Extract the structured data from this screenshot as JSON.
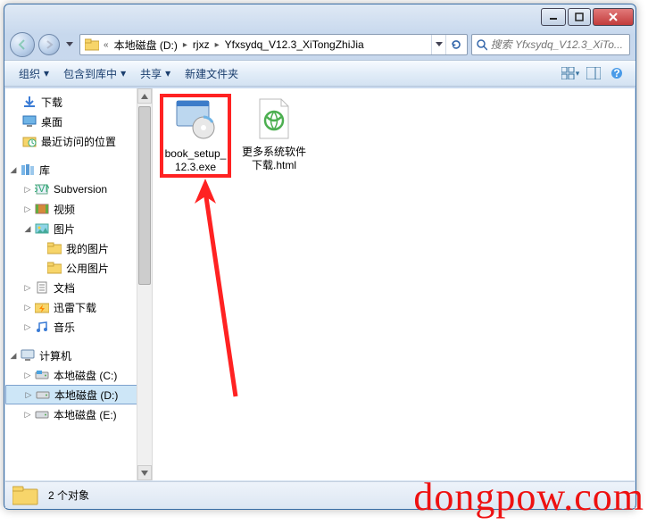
{
  "titlebar": {},
  "breadcrumb": {
    "segments": [
      "本地磁盘 (D:)",
      "rjxz",
      "Yfxsydq_V12.3_XiTongZhiJia"
    ],
    "prefix": "«"
  },
  "search": {
    "placeholder": "搜索 Yfxsydq_V12.3_XiTo..."
  },
  "toolbar": {
    "organize": "组织",
    "include": "包含到库中",
    "share": "共享",
    "newfolder": "新建文件夹"
  },
  "sidebar": {
    "favorites_items": [
      {
        "label": "下载",
        "icon": "download"
      },
      {
        "label": "桌面",
        "icon": "desktop"
      },
      {
        "label": "最近访问的位置",
        "icon": "recent"
      }
    ],
    "libraries_label": "库",
    "libraries_items": [
      {
        "label": "Subversion",
        "icon": "svn"
      },
      {
        "label": "视频",
        "icon": "video"
      },
      {
        "label": "图片",
        "icon": "pictures",
        "expanded": true,
        "children": [
          {
            "label": "我的图片",
            "icon": "folder"
          },
          {
            "label": "公用图片",
            "icon": "folder"
          }
        ]
      },
      {
        "label": "文档",
        "icon": "docs"
      },
      {
        "label": "迅雷下载",
        "icon": "thunder"
      },
      {
        "label": "音乐",
        "icon": "music"
      }
    ],
    "computer_label": "计算机",
    "drives": [
      {
        "label": "本地磁盘 (C:)",
        "icon": "drive-sys"
      },
      {
        "label": "本地磁盘 (D:)",
        "icon": "drive",
        "selected": true
      },
      {
        "label": "本地磁盘 (E:)",
        "icon": "drive"
      }
    ]
  },
  "files": [
    {
      "name": "book_setup_12.3.exe",
      "type": "exe",
      "highlighted": true
    },
    {
      "name": "更多系统软件下载.html",
      "type": "html"
    }
  ],
  "status": {
    "count_text": "2 个对象"
  },
  "watermark": "dongpow.com"
}
